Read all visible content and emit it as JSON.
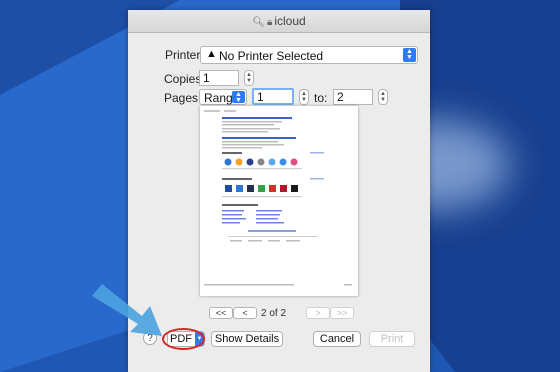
{
  "titlebar": {
    "title": "icloud"
  },
  "printer": {
    "label": "Printer:",
    "value": "No Printer Selected"
  },
  "copies": {
    "label": "Copies:",
    "value": "1"
  },
  "pages": {
    "label": "Pages:",
    "mode": "Range",
    "from": "1",
    "to_label": "to:",
    "to": "2"
  },
  "pagination": {
    "first": "<<",
    "prev": "<",
    "indicator": "2 of 2",
    "next": ">",
    "last": ">>"
  },
  "buttons": {
    "help": "?",
    "pdf": "PDF",
    "show_details": "Show Details",
    "cancel": "Cancel",
    "print": "Print"
  },
  "colors": {
    "accent": "#2e7bf6",
    "highlight_ring": "#d92424",
    "arrow": "#4aa3e0"
  }
}
